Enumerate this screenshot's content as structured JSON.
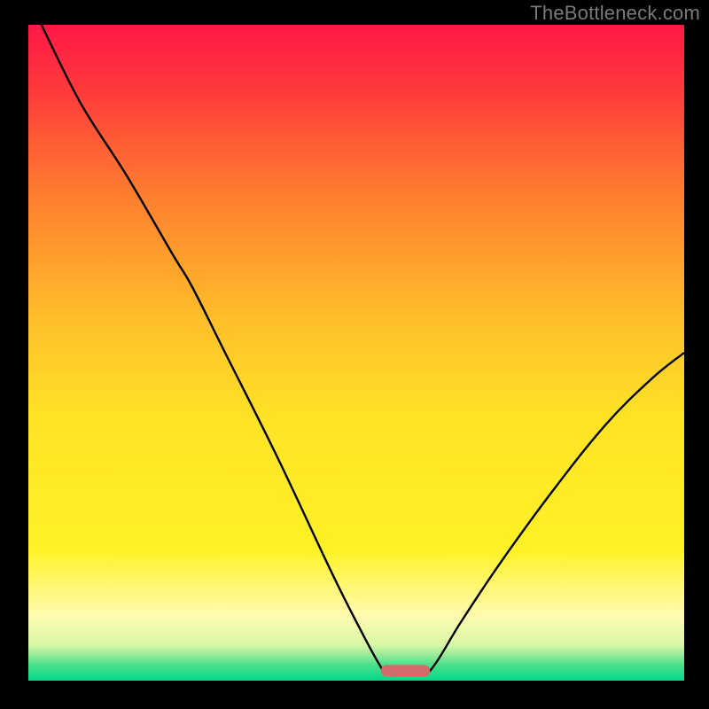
{
  "attribution": "TheBottleneck.com",
  "chart_data": {
    "type": "line",
    "title": "",
    "xlabel": "",
    "ylabel": "",
    "xlim": [
      0,
      100
    ],
    "ylim": [
      0,
      100
    ],
    "grid": false,
    "background": {
      "stops": [
        {
          "offset": 0.0,
          "color": "#ff1846"
        },
        {
          "offset": 0.1,
          "color": "#ff3a3c"
        },
        {
          "offset": 0.25,
          "color": "#ff7a2f"
        },
        {
          "offset": 0.45,
          "color": "#ffbf2a"
        },
        {
          "offset": 0.6,
          "color": "#ffe326"
        },
        {
          "offset": 0.8,
          "color": "#fff226"
        },
        {
          "offset": 0.9,
          "color": "#fffbb0"
        },
        {
          "offset": 0.945,
          "color": "#d9f7a6"
        },
        {
          "offset": 0.96,
          "color": "#9aeb9a"
        },
        {
          "offset": 0.975,
          "color": "#4fe08a"
        },
        {
          "offset": 1.0,
          "color": "#00d98a"
        }
      ]
    },
    "series": [
      {
        "name": "bottleneck-curve",
        "color": "#000000",
        "width": 2.4,
        "points": [
          {
            "x": 2.0,
            "y": 100.0
          },
          {
            "x": 8.0,
            "y": 88.0
          },
          {
            "x": 15.0,
            "y": 77.0
          },
          {
            "x": 22.0,
            "y": 65.0
          },
          {
            "x": 25.0,
            "y": 60.0
          },
          {
            "x": 30.0,
            "y": 50.0
          },
          {
            "x": 38.0,
            "y": 34.0
          },
          {
            "x": 46.0,
            "y": 17.0
          },
          {
            "x": 50.0,
            "y": 9.0
          },
          {
            "x": 53.5,
            "y": 2.5
          },
          {
            "x": 55.0,
            "y": 1.0
          },
          {
            "x": 60.0,
            "y": 1.0
          },
          {
            "x": 62.0,
            "y": 2.5
          },
          {
            "x": 66.0,
            "y": 9.0
          },
          {
            "x": 72.0,
            "y": 18.0
          },
          {
            "x": 80.0,
            "y": 29.0
          },
          {
            "x": 88.0,
            "y": 39.0
          },
          {
            "x": 95.0,
            "y": 46.0
          },
          {
            "x": 100.0,
            "y": 50.0
          }
        ]
      }
    ],
    "marker": {
      "color": "#d46a6a",
      "x_center": 57.5,
      "x_width": 7.5,
      "y": 0.6,
      "height": 1.8
    }
  }
}
